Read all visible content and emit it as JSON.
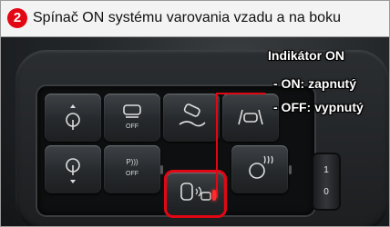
{
  "header": {
    "step_number": "2",
    "title": "Spínač ON systému varovania vzadu a na boku"
  },
  "callout": {
    "line1": "Indikátor ON",
    "line2": "- ON: zapnutý",
    "line3": "- OFF: vypnutý"
  },
  "buttons": {
    "row1_2_label": "OFF",
    "row2_2_label": "OFF",
    "row2_2_symbol": "P)))"
  },
  "wheel": {
    "top_value": "1",
    "bottom_value": "0"
  },
  "colors": {
    "accent": "#e30613",
    "indicator": "#ff2a2a"
  },
  "icons": [
    "steering-up-down-icon",
    "car-off-icon",
    "car-drift-icon",
    "lane-assist-icon",
    "steering-down-icon",
    "parking-sensor-off-icon",
    "rear-side-warning-icon",
    "heated-steering-icon"
  ]
}
